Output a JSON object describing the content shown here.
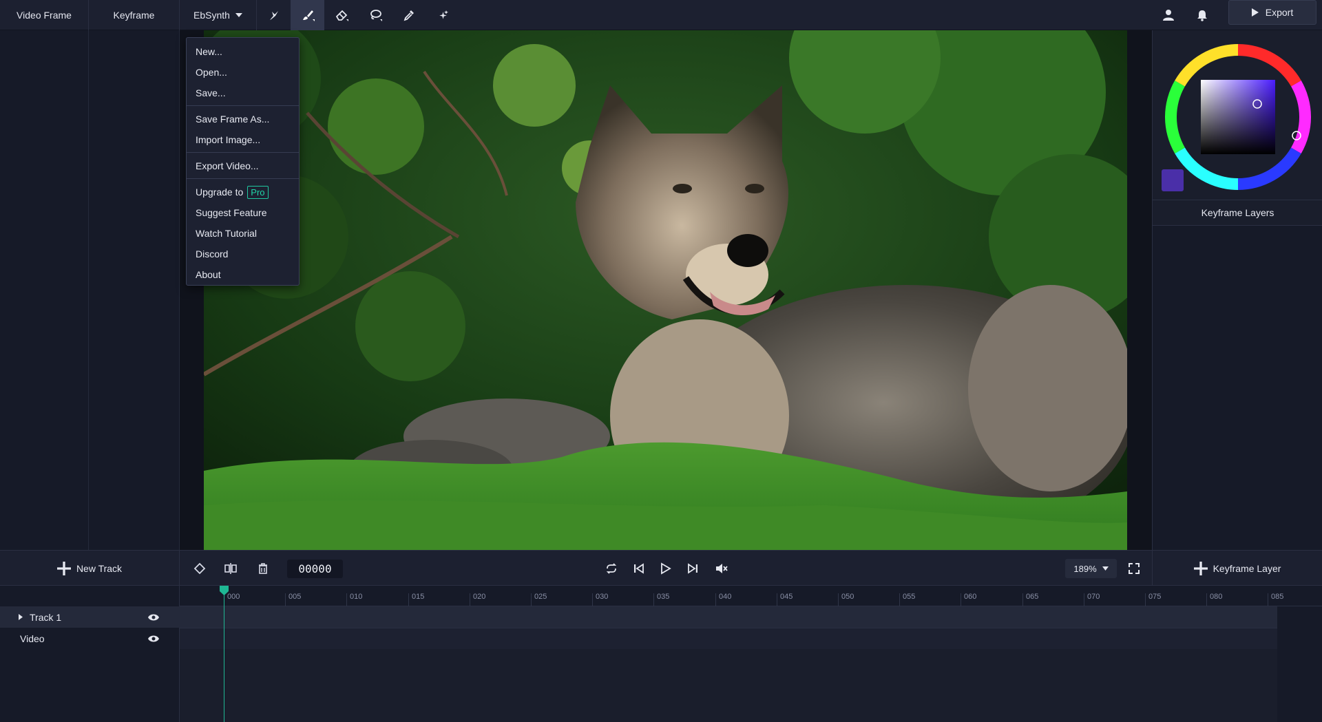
{
  "topbar": {
    "tabs": [
      {
        "label": "Video Frame"
      },
      {
        "label": "Keyframe"
      }
    ],
    "app_menu_label": "EbSynth",
    "tools": [
      "brush-pointer-icon",
      "paint-brush-icon",
      "eraser-icon",
      "lasso-icon",
      "eyedropper-icon",
      "magic-sparkle-icon"
    ],
    "active_tool": "paint-brush-icon",
    "export_label": "Export"
  },
  "menu": {
    "items": [
      {
        "label": "New..."
      },
      {
        "label": "Open..."
      },
      {
        "label": "Save..."
      },
      {
        "label": "Save Frame As..."
      },
      {
        "label": "Import Image..."
      },
      {
        "label": "Export Video..."
      },
      {
        "label": "Upgrade to",
        "badge": "Pro"
      },
      {
        "label": "Suggest Feature"
      },
      {
        "label": "Watch Tutorial"
      },
      {
        "label": "Discord"
      },
      {
        "label": "About"
      }
    ]
  },
  "right_panel": {
    "current_color": "#4a2fa8",
    "layers_title": "Keyframe Layers"
  },
  "controls": {
    "new_track_label": "New Track",
    "frame": "00000",
    "zoom": "189%",
    "keyframe_layer_label": "Keyframe Layer"
  },
  "timeline": {
    "ticks": [
      "000",
      "005",
      "010",
      "015",
      "020",
      "025",
      "030",
      "035",
      "040",
      "045",
      "050",
      "055",
      "060",
      "065",
      "070",
      "075",
      "080",
      "085"
    ],
    "tracks": [
      {
        "label": "Track 1"
      },
      {
        "label": "Video"
      }
    ],
    "playhead_frame": 0
  },
  "colors": {
    "accent": "#1fb894",
    "background": "#161a28",
    "panel": "#1c2030"
  }
}
